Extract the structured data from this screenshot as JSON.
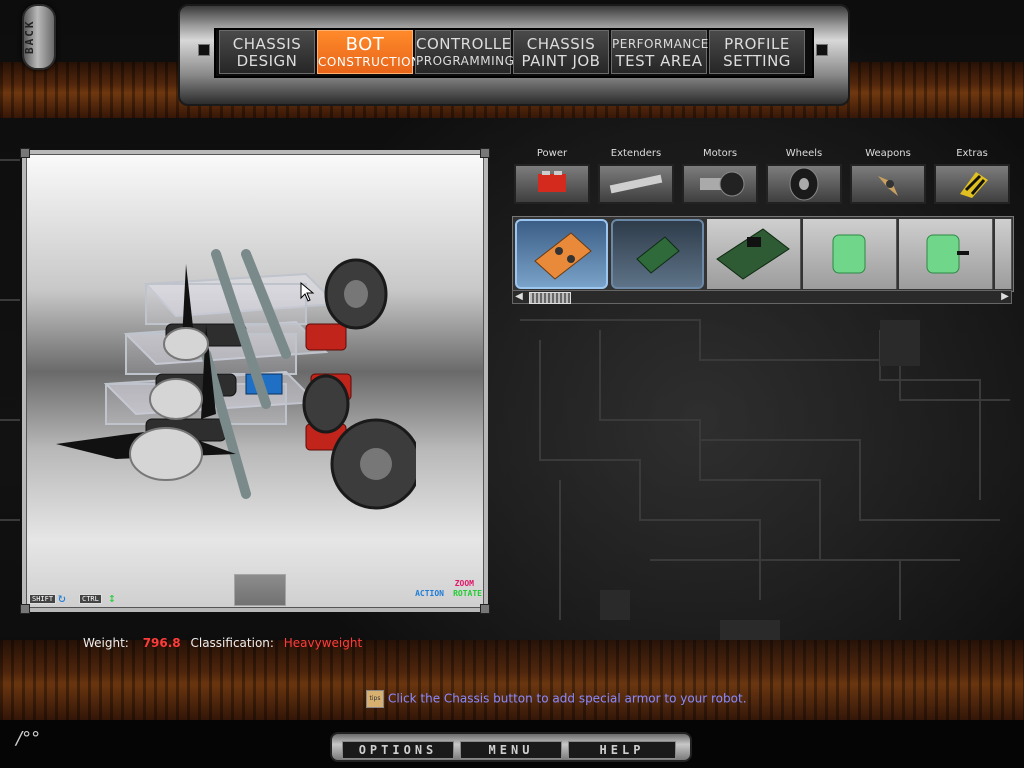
{
  "back_button": {
    "label": "BACK"
  },
  "nav": [
    {
      "line1": "CHASSIS",
      "line2": "DESIGN",
      "active": false
    },
    {
      "line1": "BOT",
      "line2": "CONSTRUCTION",
      "active": true
    },
    {
      "line1": "CONTROLLER",
      "line2": "PROGRAMMING",
      "active": false
    },
    {
      "line1": "CHASSIS",
      "line2": "PAINT JOB",
      "active": false
    },
    {
      "line1": "PERFORMANCE",
      "line2": "TEST AREA",
      "active": false
    },
    {
      "line1": "PROFILE",
      "line2": "SETTING",
      "active": false
    }
  ],
  "categories": [
    {
      "label": "Power",
      "icon": "battery-icon"
    },
    {
      "label": "Extenders",
      "icon": "extender-bar-icon"
    },
    {
      "label": "Motors",
      "icon": "motor-icon"
    },
    {
      "label": "Wheels",
      "icon": "wheel-icon"
    },
    {
      "label": "Weapons",
      "icon": "weapon-blade-icon"
    },
    {
      "label": "Extras",
      "icon": "hazard-stripes-icon"
    }
  ],
  "parts": [
    {
      "name": "orange-controller-board",
      "selected": true
    },
    {
      "name": "green-receiver-board",
      "selected": false,
      "dim": true
    },
    {
      "name": "green-circuit-board",
      "selected": false
    },
    {
      "name": "green-battery-pack",
      "selected": false
    },
    {
      "name": "green-battery-pack-with-lead",
      "selected": false
    }
  ],
  "viewport_hints": {
    "shift": "SHIFT",
    "ctrl": "CTRL",
    "action": "ACTION",
    "zoom": "ZOOM",
    "rotate": "ROTATE"
  },
  "info": {
    "weight_label": "Weight:",
    "weight_value": "796.8",
    "class_label": "Classification:",
    "class_value": "Heavyweight"
  },
  "tip": {
    "icon_text": "tips",
    "text": "Click the Chassis button to add special armor to your robot."
  },
  "bottom_menu": {
    "options": "OPTIONS",
    "menu": "MENU",
    "help": "HELP"
  },
  "corner_mark": "/°°",
  "colors": {
    "active_tab": "#e8651a",
    "value_red": "#ff3c3c",
    "tip_text": "#8a8aff",
    "action_blue": "#1e7bd6",
    "zoom_pink": "#e0186a",
    "rotate_green": "#22cc33"
  }
}
